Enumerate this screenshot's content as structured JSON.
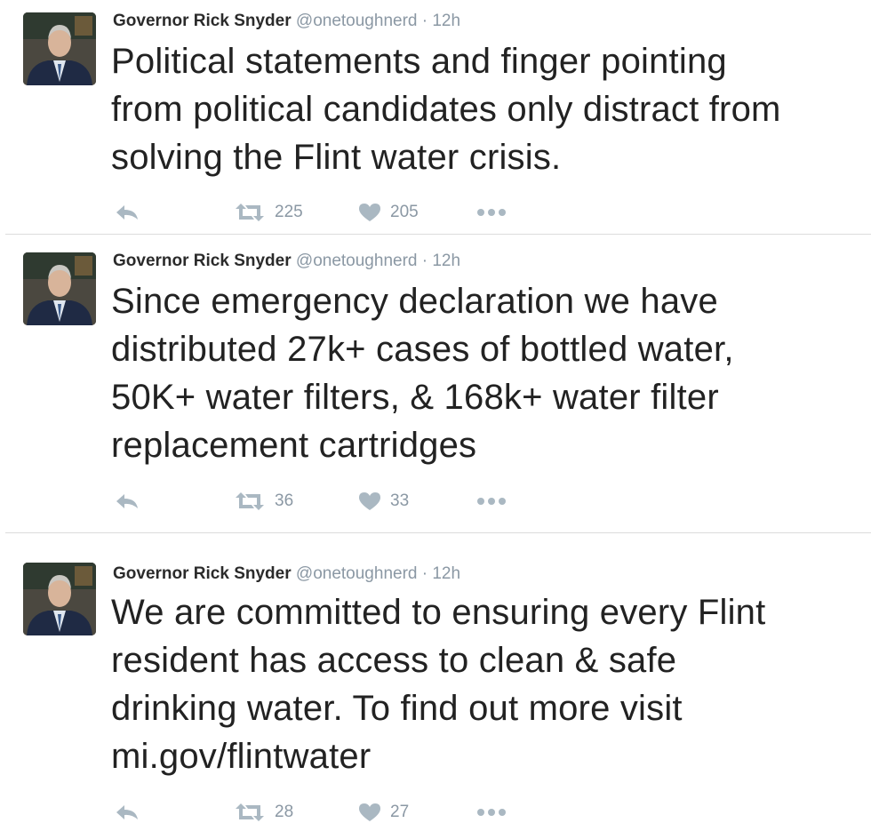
{
  "tweets": [
    {
      "author": "Governor Rick Snyder",
      "handle": "@onetoughnerd",
      "separator": "·",
      "time": "12h",
      "text": "Political statements and finger pointing\nfrom political candidates only distract from\nsolving the Flint water crisis.",
      "retweets": "225",
      "likes": "205"
    },
    {
      "author": "Governor Rick Snyder",
      "handle": "@onetoughnerd",
      "separator": "·",
      "time": "12h",
      "text": "Since emergency declaration we have\ndistributed 27k+ cases of bottled water,\n50K+ water filters, & 168k+ water filter\nreplacement cartridges",
      "retweets": "36",
      "likes": "33"
    },
    {
      "author": "Governor Rick Snyder",
      "handle": "@onetoughnerd",
      "separator": "·",
      "time": "12h",
      "text": "We are committed to ensuring every Flint\nresident has access to clean & safe\ndrinking water. To find out more visit\nmi.gov/flintwater",
      "retweets": "28",
      "likes": "27"
    }
  ],
  "icons": {
    "reply": "reply-icon",
    "retweet": "retweet-icon",
    "like": "heart-icon",
    "more": "more-dots-icon"
  },
  "colors": {
    "icon_gray": "#aab8c2",
    "meta_gray": "#8b98a4",
    "text": "#222222"
  }
}
